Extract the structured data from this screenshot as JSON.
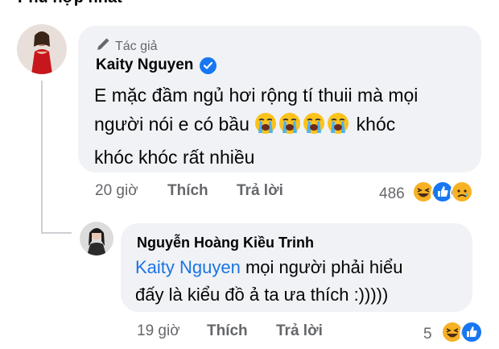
{
  "section_header": "Phù hợp nhất",
  "comment": {
    "author_badge": "Tác giả",
    "author": "Kaity Nguyen",
    "text_line1": "E mặc đầm ngủ hơi rộng tí thuii mà mọi",
    "text_line2_pre": "người nói e có bầu",
    "text_line2_post": "khóc",
    "text_line3": "khóc khóc rất nhiều",
    "time": "20 giờ",
    "like_label": "Thích",
    "reply_label": "Trả lời",
    "reaction_count": "486",
    "reaction_icons": [
      "laughing-emoji",
      "like-emoji",
      "sad-emoji"
    ],
    "inline_emojis": [
      "loudly-crying-emoji",
      "loudly-crying-emoji",
      "loudly-crying-emoji",
      "loudly-crying-emoji"
    ]
  },
  "reply": {
    "author": "Nguyễn Hoàng Kiều Trinh",
    "mention": "Kaity Nguyen",
    "text_line1_rest": " mọi người phải hiểu",
    "text_line2": "đấy là kiểu đồ ả ta ưa thích :)))))",
    "time": "19 giờ",
    "like_label": "Thích",
    "reply_label": "Trả lời",
    "reaction_count": "5",
    "reaction_icons": [
      "laughing-emoji",
      "like-emoji"
    ]
  },
  "colors": {
    "bubble": "#f0f2f5",
    "mention": "#1b74e4",
    "meta": "#65676b",
    "verified": "#1877f2"
  }
}
